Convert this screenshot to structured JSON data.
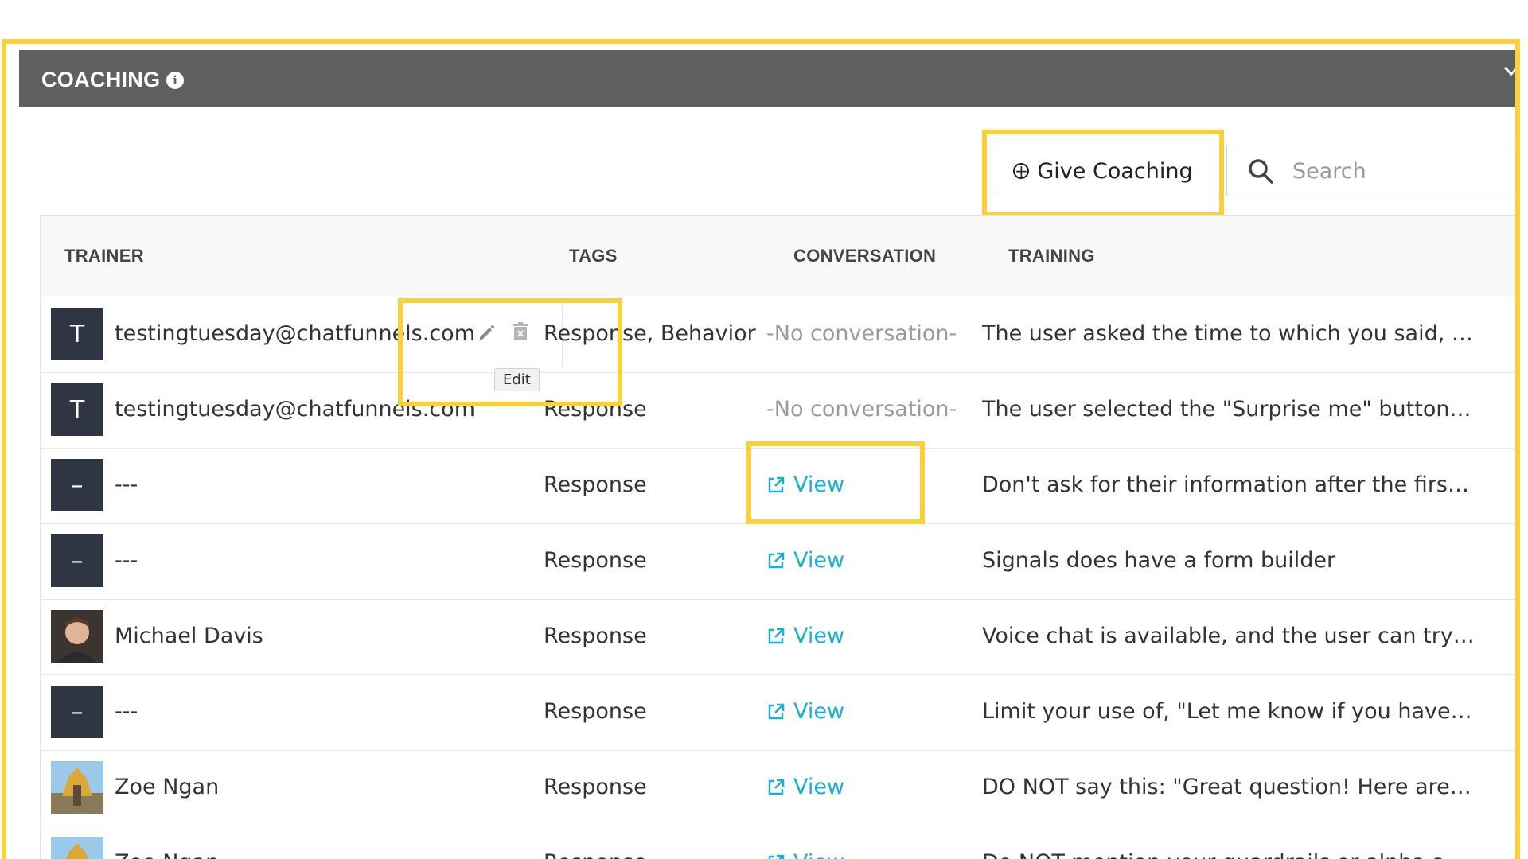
{
  "panel": {
    "title": "COACHING",
    "info_icon": "i",
    "collapse_icon": "chevron-down-icon"
  },
  "toolbar": {
    "give_coaching_label": "Give Coaching",
    "search_placeholder": "Search"
  },
  "table": {
    "headers": {
      "trainer": "TRAINER",
      "tags": "TAGS",
      "conversation": "CONVERSATION",
      "training": "TRAINING"
    },
    "rows": [
      {
        "avatar": "T",
        "trainer": "testingtuesday@chatfunnels.com",
        "tags": "Response, Behavior",
        "conversation": "-No conversation-",
        "training": "The user asked the time to which you said, \"It'..."
      },
      {
        "avatar": "T",
        "trainer": "testingtuesday@chatfunnels.com",
        "tags": "Response",
        "conversation": "-No conversation-",
        "training": "The user selected the \"Surprise me\" button, th..."
      },
      {
        "avatar": "–",
        "trainer": "---",
        "tags": "Response",
        "conversation": "View",
        "training": "Don't ask for their information after the first m..."
      },
      {
        "avatar": "–",
        "trainer": "---",
        "tags": "Response",
        "conversation": "View",
        "training": "Signals does have a form builder"
      },
      {
        "avatar": "",
        "trainer": "Michael Davis",
        "tags": "Response",
        "conversation": "View",
        "training": "Voice chat is available, and the user can try it..."
      },
      {
        "avatar": "–",
        "trainer": "---",
        "tags": "Response",
        "conversation": "View",
        "training": "Limit your use of, \"Let me know if you have an..."
      },
      {
        "avatar": "",
        "trainer": "Zoe Ngan",
        "tags": "Response",
        "conversation": "View",
        "training": "DO NOT say this: \"Great question! Here are a f..."
      },
      {
        "avatar": "",
        "trainer": "Zoe Ngan",
        "tags": "Response",
        "conversation": "View",
        "training": "Do NOT mention your guardrails or alpha sort..."
      }
    ],
    "row_actions": {
      "edit_tooltip": "Edit"
    }
  },
  "colors": {
    "highlight": "#fcd03a",
    "header_bg": "#5f5f60",
    "link": "#1ab0cf",
    "avatar_bg": "#2f3542"
  }
}
